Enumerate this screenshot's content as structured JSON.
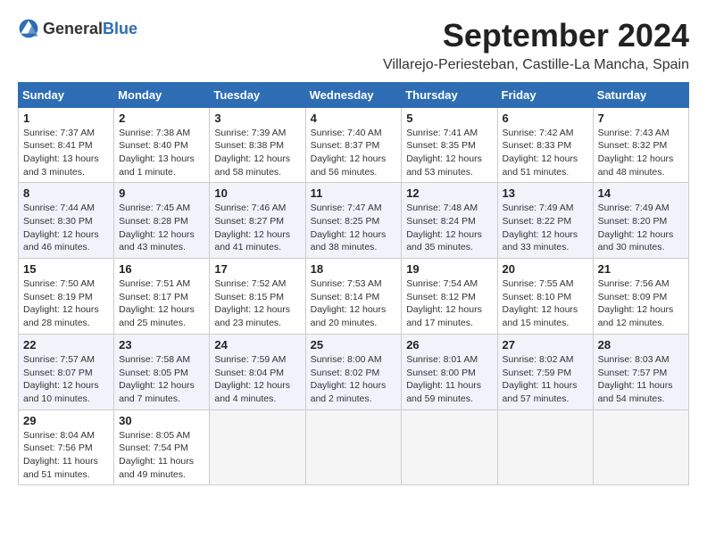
{
  "header": {
    "logo_general": "General",
    "logo_blue": "Blue",
    "month_title": "September 2024",
    "location": "Villarejo-Periesteban, Castille-La Mancha, Spain"
  },
  "calendar": {
    "days_of_week": [
      "Sunday",
      "Monday",
      "Tuesday",
      "Wednesday",
      "Thursday",
      "Friday",
      "Saturday"
    ],
    "weeks": [
      [
        {
          "day": "",
          "info": ""
        },
        {
          "day": "2",
          "info": "Sunrise: 7:38 AM\nSunset: 8:40 PM\nDaylight: 13 hours\nand 1 minute."
        },
        {
          "day": "3",
          "info": "Sunrise: 7:39 AM\nSunset: 8:38 PM\nDaylight: 12 hours\nand 58 minutes."
        },
        {
          "day": "4",
          "info": "Sunrise: 7:40 AM\nSunset: 8:37 PM\nDaylight: 12 hours\nand 56 minutes."
        },
        {
          "day": "5",
          "info": "Sunrise: 7:41 AM\nSunset: 8:35 PM\nDaylight: 12 hours\nand 53 minutes."
        },
        {
          "day": "6",
          "info": "Sunrise: 7:42 AM\nSunset: 8:33 PM\nDaylight: 12 hours\nand 51 minutes."
        },
        {
          "day": "7",
          "info": "Sunrise: 7:43 AM\nSunset: 8:32 PM\nDaylight: 12 hours\nand 48 minutes."
        }
      ],
      [
        {
          "day": "8",
          "info": "Sunrise: 7:44 AM\nSunset: 8:30 PM\nDaylight: 12 hours\nand 46 minutes."
        },
        {
          "day": "9",
          "info": "Sunrise: 7:45 AM\nSunset: 8:28 PM\nDaylight: 12 hours\nand 43 minutes."
        },
        {
          "day": "10",
          "info": "Sunrise: 7:46 AM\nSunset: 8:27 PM\nDaylight: 12 hours\nand 41 minutes."
        },
        {
          "day": "11",
          "info": "Sunrise: 7:47 AM\nSunset: 8:25 PM\nDaylight: 12 hours\nand 38 minutes."
        },
        {
          "day": "12",
          "info": "Sunrise: 7:48 AM\nSunset: 8:24 PM\nDaylight: 12 hours\nand 35 minutes."
        },
        {
          "day": "13",
          "info": "Sunrise: 7:49 AM\nSunset: 8:22 PM\nDaylight: 12 hours\nand 33 minutes."
        },
        {
          "day": "14",
          "info": "Sunrise: 7:49 AM\nSunset: 8:20 PM\nDaylight: 12 hours\nand 30 minutes."
        }
      ],
      [
        {
          "day": "15",
          "info": "Sunrise: 7:50 AM\nSunset: 8:19 PM\nDaylight: 12 hours\nand 28 minutes."
        },
        {
          "day": "16",
          "info": "Sunrise: 7:51 AM\nSunset: 8:17 PM\nDaylight: 12 hours\nand 25 minutes."
        },
        {
          "day": "17",
          "info": "Sunrise: 7:52 AM\nSunset: 8:15 PM\nDaylight: 12 hours\nand 23 minutes."
        },
        {
          "day": "18",
          "info": "Sunrise: 7:53 AM\nSunset: 8:14 PM\nDaylight: 12 hours\nand 20 minutes."
        },
        {
          "day": "19",
          "info": "Sunrise: 7:54 AM\nSunset: 8:12 PM\nDaylight: 12 hours\nand 17 minutes."
        },
        {
          "day": "20",
          "info": "Sunrise: 7:55 AM\nSunset: 8:10 PM\nDaylight: 12 hours\nand 15 minutes."
        },
        {
          "day": "21",
          "info": "Sunrise: 7:56 AM\nSunset: 8:09 PM\nDaylight: 12 hours\nand 12 minutes."
        }
      ],
      [
        {
          "day": "22",
          "info": "Sunrise: 7:57 AM\nSunset: 8:07 PM\nDaylight: 12 hours\nand 10 minutes."
        },
        {
          "day": "23",
          "info": "Sunrise: 7:58 AM\nSunset: 8:05 PM\nDaylight: 12 hours\nand 7 minutes."
        },
        {
          "day": "24",
          "info": "Sunrise: 7:59 AM\nSunset: 8:04 PM\nDaylight: 12 hours\nand 4 minutes."
        },
        {
          "day": "25",
          "info": "Sunrise: 8:00 AM\nSunset: 8:02 PM\nDaylight: 12 hours\nand 2 minutes."
        },
        {
          "day": "26",
          "info": "Sunrise: 8:01 AM\nSunset: 8:00 PM\nDaylight: 11 hours\nand 59 minutes."
        },
        {
          "day": "27",
          "info": "Sunrise: 8:02 AM\nSunset: 7:59 PM\nDaylight: 11 hours\nand 57 minutes."
        },
        {
          "day": "28",
          "info": "Sunrise: 8:03 AM\nSunset: 7:57 PM\nDaylight: 11 hours\nand 54 minutes."
        }
      ],
      [
        {
          "day": "29",
          "info": "Sunrise: 8:04 AM\nSunset: 7:56 PM\nDaylight: 11 hours\nand 51 minutes."
        },
        {
          "day": "30",
          "info": "Sunrise: 8:05 AM\nSunset: 7:54 PM\nDaylight: 11 hours\nand 49 minutes."
        },
        {
          "day": "",
          "info": ""
        },
        {
          "day": "",
          "info": ""
        },
        {
          "day": "",
          "info": ""
        },
        {
          "day": "",
          "info": ""
        },
        {
          "day": "",
          "info": ""
        }
      ]
    ],
    "first_week_sunday": {
      "day": "1",
      "info": "Sunrise: 7:37 AM\nSunset: 8:41 PM\nDaylight: 13 hours\nand 3 minutes."
    }
  }
}
